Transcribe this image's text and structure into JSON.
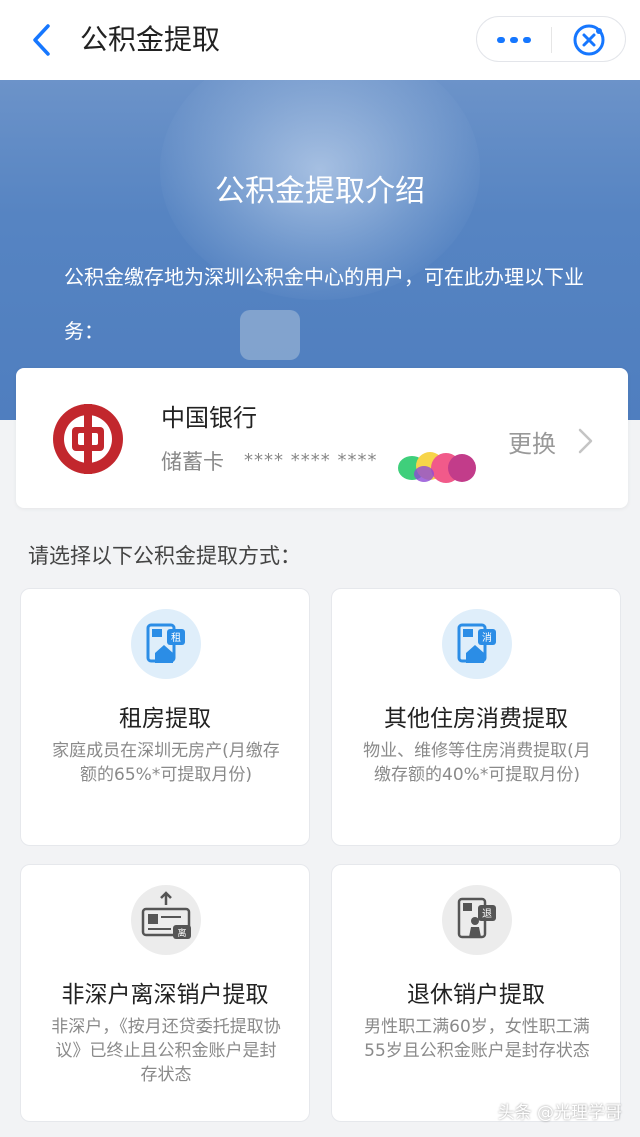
{
  "nav": {
    "title": "公积金提取",
    "more_icon": "more-dots-icon",
    "close_icon": "close-target-icon",
    "accent": "#1677ff"
  },
  "banner": {
    "title": "公积金提取介绍",
    "description": "公积金缴存地为深圳公积金中心的用户，可在此办理以下业务："
  },
  "bank_card": {
    "bank_name": "中国银行",
    "card_type": "储蓄卡",
    "card_number": "**** **** ****",
    "change_label": "更换",
    "logo_color": "#c2272d"
  },
  "prompt": "请选择以下公积金提取方式：",
  "options": [
    {
      "icon": "rent-house-icon",
      "title": "租房提取",
      "description": "家庭成员在深圳无房产(月缴存额的65%*可提取月份)"
    },
    {
      "icon": "housing-consumption-icon",
      "title": "其他住房消费提取",
      "description": "物业、维修等住房消费提取(月缴存额的40%*可提取月份)"
    },
    {
      "icon": "leave-shenzhen-icon",
      "title": "非深户离深销户提取",
      "description": "非深户，《按月还贷委托提取协议》已终止且公积金账户是封存状态"
    },
    {
      "icon": "retirement-icon",
      "title": "退休销户提取",
      "description": "男性职工满60岁，女性职工满55岁且公积金账户是封存状态"
    }
  ],
  "watermark": "头条 @光理学哥"
}
